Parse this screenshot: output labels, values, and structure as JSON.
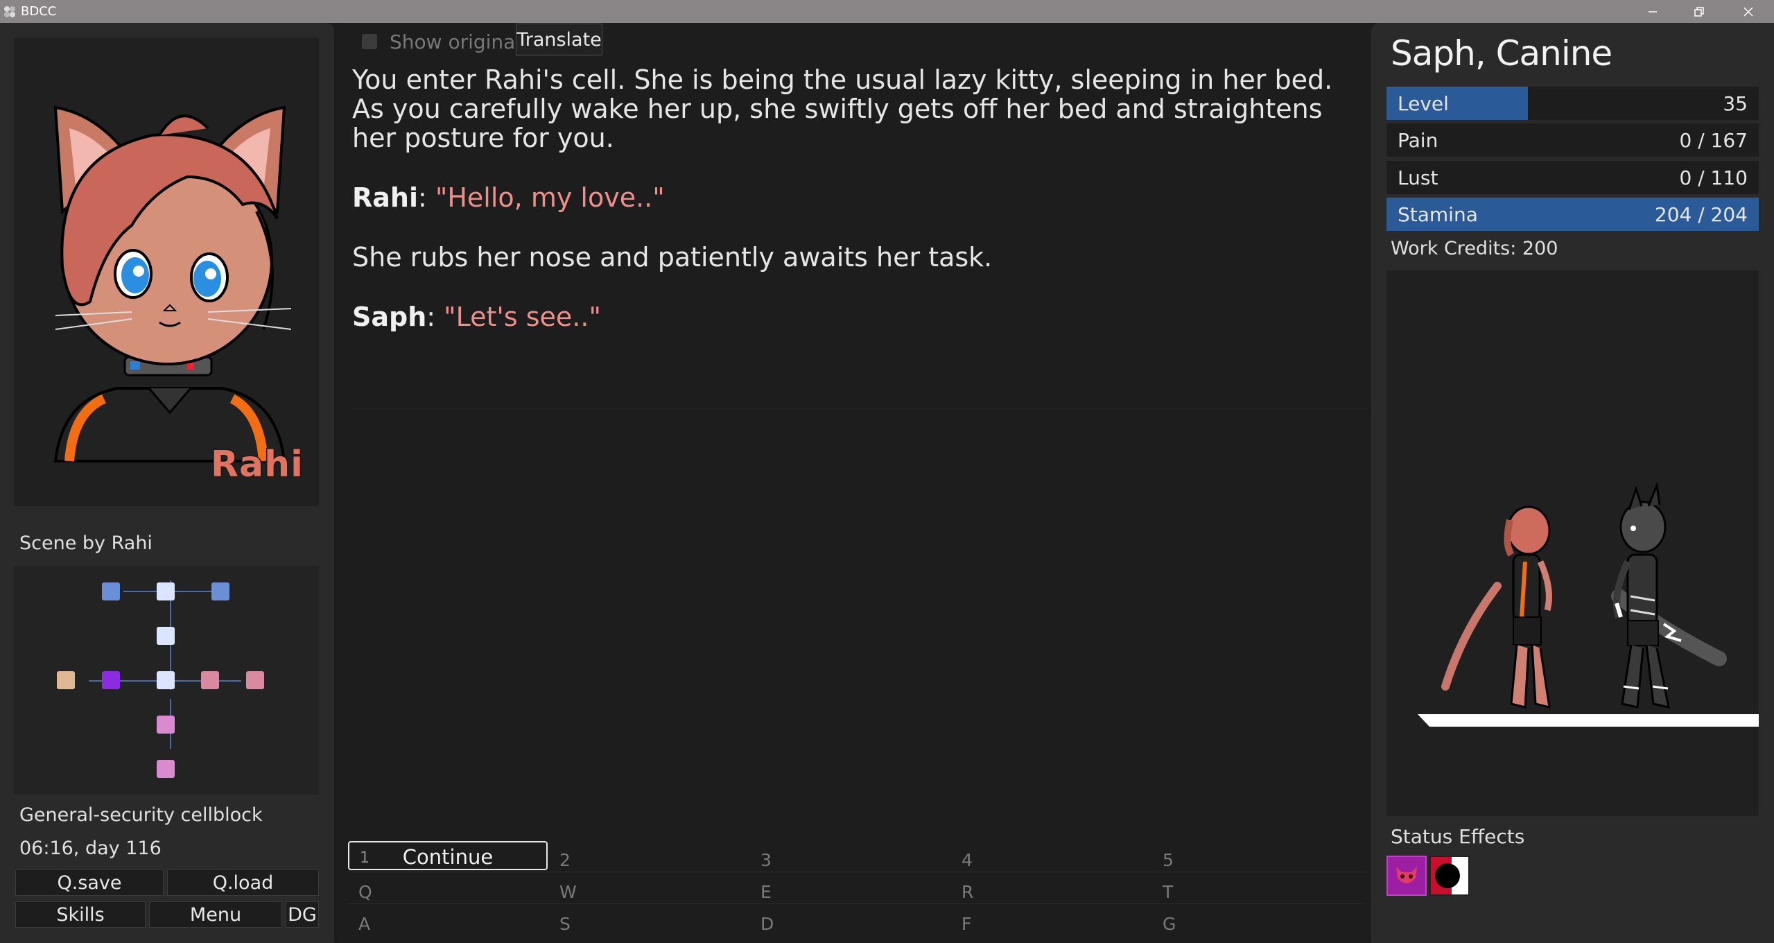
{
  "window": {
    "title": "BDCC",
    "icon": "app-icon"
  },
  "left": {
    "portrait_name": "Rahi",
    "scene_label": "Scene by Rahi",
    "location": "General-security cellblock",
    "time": "06:16, day 116",
    "buttons": {
      "qsave": "Q.save",
      "qload": "Q.load",
      "skills": "Skills",
      "menu": "Menu",
      "dg": "DG"
    }
  },
  "middle": {
    "show_original": "Show original",
    "translate": "Translate",
    "narration_1": "You enter Rahi's cell. She is being the usual lazy kitty, sleeping in her bed. As you carefully wake her up, she swiftly gets off her bed and straightens her posture for you.",
    "line_1": {
      "speaker": "Rahi",
      "sep": ": ",
      "quote": "\"Hello, my love..\""
    },
    "narration_2": "She rubs her nose and patiently awaits her task.",
    "line_2": {
      "speaker": "Saph",
      "sep": ": ",
      "quote": "\"Let's see..\""
    },
    "options": {
      "continue_key": "1",
      "continue_label": "Continue",
      "row1": [
        "2",
        "3",
        "4",
        "5"
      ],
      "row2": [
        "Q",
        "W",
        "E",
        "R",
        "T"
      ],
      "row3": [
        "A",
        "S",
        "D",
        "F",
        "G"
      ]
    }
  },
  "right": {
    "name": "Saph, Canine",
    "stats": [
      {
        "name": "Level",
        "value": "35",
        "fill": 0.38
      },
      {
        "name": "Pain",
        "value": "0 / 167",
        "fill": 0
      },
      {
        "name": "Lust",
        "value": "0 / 110",
        "fill": 0
      },
      {
        "name": "Stamina",
        "value": "204 / 204",
        "fill": 1.0
      }
    ],
    "credits": "Work Credits: 200",
    "status_title": "Status Effects",
    "effects": [
      "demon-face-icon",
      "dark-orb-icon"
    ]
  },
  "colors": {
    "accent": "#2b5a99",
    "quote": "#ee8f8a",
    "portrait_name": "#e07460"
  }
}
